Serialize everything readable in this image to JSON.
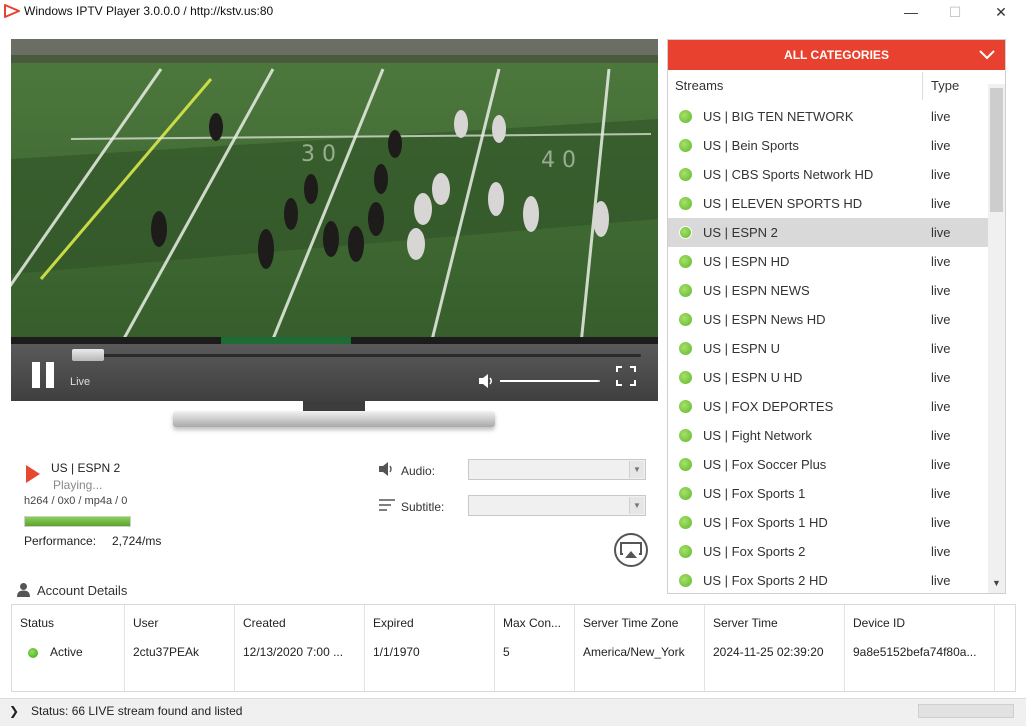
{
  "window": {
    "title": "Windows IPTV Player 3.0.0.0 / http://kstv.us:80",
    "minimize": "—",
    "maximize": "☐",
    "close": "✕"
  },
  "player": {
    "live_label": "Live",
    "volume_level": 0.98,
    "progress": 0.04
  },
  "now_playing": {
    "title": "US | ESPN 2",
    "status": "Playing...",
    "codec": "h264 / 0x0 / mp4a / 0",
    "performance_label": "Performance:",
    "performance_value": "2,724/ms",
    "performance_level": 1.0
  },
  "tracks": {
    "audio_label": "Audio:",
    "audio_value": "",
    "subtitle_label": "Subtitle:",
    "subtitle_value": ""
  },
  "streams": {
    "category": "ALL CATEGORIES",
    "col_streams": "Streams",
    "col_type": "Type",
    "selected_index": 4,
    "items": [
      {
        "name": "US | BIG TEN NETWORK",
        "type": "live"
      },
      {
        "name": "US | Bein Sports",
        "type": "live"
      },
      {
        "name": "US | CBS Sports Network HD",
        "type": "live"
      },
      {
        "name": "US | ELEVEN SPORTS HD",
        "type": "live"
      },
      {
        "name": "US | ESPN 2",
        "type": "live"
      },
      {
        "name": "US | ESPN HD",
        "type": "live"
      },
      {
        "name": "US | ESPN NEWS",
        "type": "live"
      },
      {
        "name": "US | ESPN News HD",
        "type": "live"
      },
      {
        "name": "US | ESPN U",
        "type": "live"
      },
      {
        "name": "US | ESPN U HD",
        "type": "live"
      },
      {
        "name": "US | FOX DEPORTES",
        "type": "live"
      },
      {
        "name": "US | Fight Network",
        "type": "live"
      },
      {
        "name": "US | Fox Soccer Plus",
        "type": "live"
      },
      {
        "name": "US | Fox Sports 1",
        "type": "live"
      },
      {
        "name": "US | Fox Sports 1 HD",
        "type": "live"
      },
      {
        "name": "US | Fox Sports 2",
        "type": "live"
      },
      {
        "name": "US | Fox Sports 2 HD",
        "type": "live"
      }
    ]
  },
  "account": {
    "title": "Account Details",
    "headers": {
      "status": "Status",
      "user": "User",
      "created": "Created",
      "expired": "Expired",
      "max_con": "Max Con...",
      "tz": "Server Time Zone",
      "time": "Server Time",
      "device": "Device ID"
    },
    "values": {
      "status": "Active",
      "user": "2ctu37PEAk",
      "created": "12/13/2020 7:00 ...",
      "expired": "1/1/1970",
      "max_con": "5",
      "tz": "America/New_York",
      "time": "2024-11-25 02:39:20",
      "device": "9a8e5152befa74f80a..."
    }
  },
  "statusbar": {
    "text": "Status: 66 LIVE stream found and listed"
  },
  "colors": {
    "accent": "#e8412f",
    "live_dot": "#5cb82a",
    "field_green": "#3f6a33"
  },
  "icons": {
    "app": "play-triangle-icon",
    "audio": "speaker-icon",
    "subtitle": "lines-icon",
    "account": "user-icon",
    "cast": "airplay-icon"
  }
}
